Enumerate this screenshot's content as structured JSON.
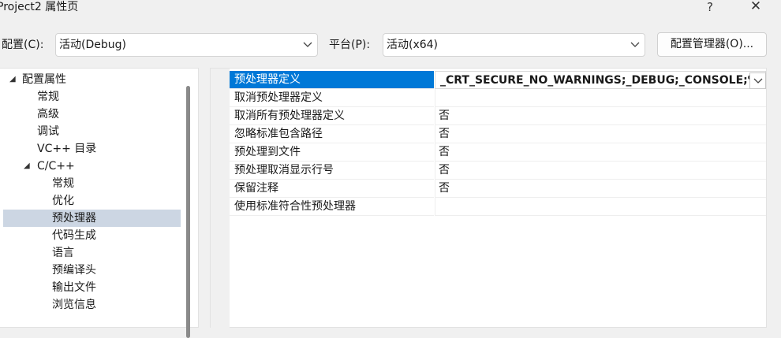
{
  "window": {
    "title": "Project2 属性页",
    "help_label": "?",
    "close_label": "✕"
  },
  "config_bar": {
    "config_label": "配置(C):",
    "config_value": "活动(Debug)",
    "platform_label": "平台(P):",
    "platform_value": "活动(x64)",
    "manager_label": "配置管理器(O)..."
  },
  "tree": {
    "items": [
      {
        "label": "配置属性",
        "expander": "◢"
      },
      {
        "label": "常规"
      },
      {
        "label": "高级"
      },
      {
        "label": "调试"
      },
      {
        "label": "VC++ 目录"
      },
      {
        "label": "C/C++",
        "expander": "◢"
      },
      {
        "label": "常规"
      },
      {
        "label": "优化"
      },
      {
        "label": "预处理器",
        "selected": true
      },
      {
        "label": "代码生成"
      },
      {
        "label": "语言"
      },
      {
        "label": "预编译头"
      },
      {
        "label": "输出文件"
      },
      {
        "label": "浏览信息"
      }
    ]
  },
  "grid": {
    "rows": [
      {
        "name": "预处理器定义",
        "value": "_CRT_SECURE_NO_WARNINGS;_DEBUG;_CONSOLE;%",
        "selected": true
      },
      {
        "name": "取消预处理器定义",
        "value": ""
      },
      {
        "name": "取消所有预处理器定义",
        "value": "否"
      },
      {
        "name": "忽略标准包含路径",
        "value": "否"
      },
      {
        "name": "预处理到文件",
        "value": "否"
      },
      {
        "name": "预处理取消显示行号",
        "value": "否"
      },
      {
        "name": "保留注释",
        "value": "否"
      },
      {
        "name": "使用标准符合性预处理器",
        "value": ""
      }
    ]
  },
  "colors": {
    "selection_blue": "#0078d7",
    "tree_selection": "#ccd6e3",
    "dialog_bg": "#f0f0f0"
  }
}
